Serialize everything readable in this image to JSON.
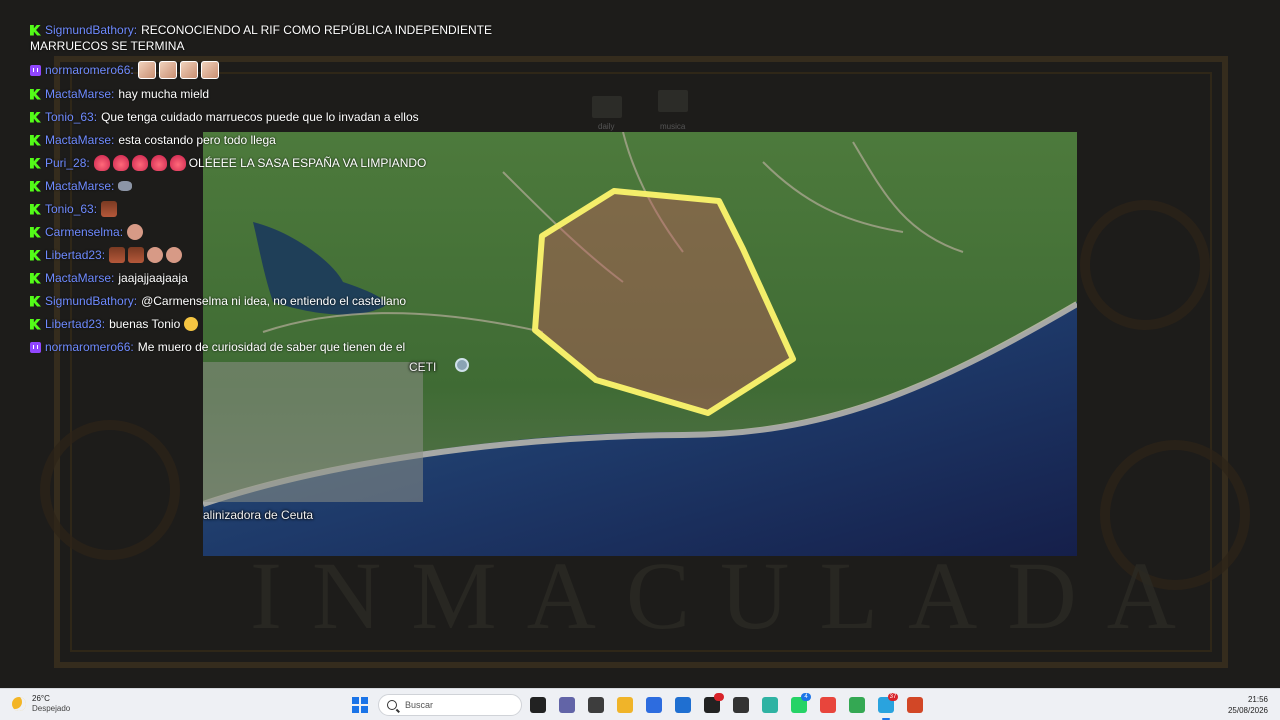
{
  "background": {
    "watermark_text": "INMACULADA",
    "desktop_icons": [
      "daily",
      "musica"
    ]
  },
  "chat": {
    "messages": [
      {
        "platform": "kick",
        "user": "SigmundBathory",
        "text": "RECONOCIENDO AL RIF COMO REPÚBLICA INDEPENDIENTE",
        "text2": "MARRUECOS SE TERMINA",
        "emotes": []
      },
      {
        "platform": "twitch",
        "user": "normaromero66",
        "text": "",
        "emotes": [
          "face",
          "face",
          "face",
          "face"
        ]
      },
      {
        "platform": "kick",
        "user": "MactaMarse",
        "text": "hay mucha mield",
        "emotes": []
      },
      {
        "platform": "kick",
        "user": "Tonio_63",
        "text": "Que tenga cuidado marruecos puede que lo invadan a ellos",
        "emotes": []
      },
      {
        "platform": "kick",
        "user": "MactaMarse",
        "text": "esta costando pero todo llega",
        "emotes": []
      },
      {
        "platform": "kick",
        "user": "Puri_28",
        "text": "OLÉEEE LA SASA ESPAÑA VA LIMPIANDO",
        "emotes": [
          "fire",
          "fire",
          "fire",
          "fire",
          "fire"
        ]
      },
      {
        "platform": "kick",
        "user": "MactaMarse",
        "text": "",
        "emotes": [
          "cat"
        ]
      },
      {
        "platform": "kick",
        "user": "Tonio_63",
        "text": "",
        "emotes": [
          "man"
        ]
      },
      {
        "platform": "kick",
        "user": "Carmenselma",
        "text": "",
        "emotes": [
          "hand"
        ]
      },
      {
        "platform": "kick",
        "user": "Libertad23",
        "text": "",
        "emotes": [
          "man",
          "man",
          "hand",
          "hand"
        ]
      },
      {
        "platform": "kick",
        "user": "MactaMarse",
        "text": "jaajajjaajaaja",
        "emotes": []
      },
      {
        "platform": "kick",
        "user": "SigmundBathory",
        "text": "@Carmenselma ni idea, no entiendo el castellano",
        "emotes": []
      },
      {
        "platform": "kick",
        "user": "Libertad23",
        "text": "buenas Tonio",
        "emotes": [],
        "trailing_emote": "clap"
      },
      {
        "platform": "twitch",
        "user": "normaromero66",
        "text": "Me muero de curiosidad de saber que tienen de el",
        "emotes": []
      }
    ]
  },
  "map": {
    "labels": {
      "ceti": "CETI",
      "desalination": "alinizadora de Ceuta"
    },
    "highlight_color": "#f4ee6a",
    "area_fill": "rgba(190,90,90,0.45)"
  },
  "taskbar": {
    "weather": {
      "temp": "26°C",
      "desc": "Despejado"
    },
    "search_placeholder": "Buscar",
    "apps": [
      {
        "name": "task-view-icon",
        "color": "#222222"
      },
      {
        "name": "teams-icon",
        "color": "#6264a7"
      },
      {
        "name": "app-icon",
        "color": "#3d3d3d"
      },
      {
        "name": "folder-icon",
        "color": "#f0b429"
      },
      {
        "name": "store-icon",
        "color": "#2d6cdf"
      },
      {
        "name": "outlook-icon",
        "color": "#1f6fd1"
      },
      {
        "name": "obs-icon",
        "color": "#222222",
        "badge": ""
      },
      {
        "name": "unity-icon",
        "color": "#333333"
      },
      {
        "name": "edge-icon",
        "color": "#2fb3a3"
      },
      {
        "name": "whatsapp-icon",
        "color": "#25d366",
        "badge": "4"
      },
      {
        "name": "chrome-icon",
        "color": "#e8453c"
      },
      {
        "name": "chrome-alt-icon",
        "color": "#34a853"
      },
      {
        "name": "telegram-icon",
        "color": "#2aa3de",
        "badge": "37"
      },
      {
        "name": "powerpoint-icon",
        "color": "#d24726"
      }
    ],
    "clock": {
      "time": "21:56",
      "date": "25/08/2026"
    }
  }
}
